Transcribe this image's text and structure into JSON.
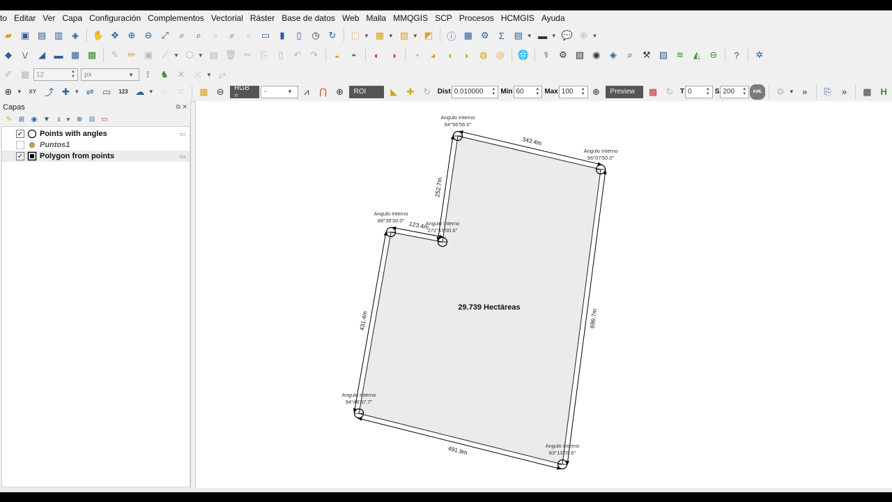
{
  "menu": [
    "to",
    "Editar",
    "Ver",
    "Capa",
    "Configuración",
    "Complementos",
    "Vectorial",
    "Ráster",
    "Base de datos",
    "Web",
    "Malla",
    "MMQGIS",
    "SCP",
    "Procesos",
    "HCMGIS",
    "Ayuda"
  ],
  "label_toolbar": {
    "font_size": "12",
    "unit": "px"
  },
  "scp_toolbar": {
    "rgb_label": "RGB =",
    "rgb_value": "-",
    "roi_label": "ROI",
    "dist_label": "Dist",
    "dist_value": "0.010000",
    "min_label": "Min",
    "min_value": "60",
    "max_label": "Max",
    "max_value": "100",
    "preview_label": "Preview",
    "t_label": "T",
    "t_value": "0",
    "s_label": "S",
    "s_value": "200",
    "kml_label": "KML",
    "more": "»",
    "num_icon": "123"
  },
  "layers_panel": {
    "title": "Capas",
    "layers": [
      {
        "name": "Points with angles",
        "checked": true,
        "icon": "circle-symbol"
      },
      {
        "name": "Puntos1",
        "checked": false,
        "icon": "point-symbol"
      },
      {
        "name": "Polygon from points",
        "checked": true,
        "icon": "polygon-symbol"
      }
    ]
  },
  "map": {
    "area_label": "29.739 Hectáreas",
    "fill_color": "#ebebeb",
    "vertices": [
      {
        "title": "Angulo Interno",
        "angle": "84°56'56.0\""
      },
      {
        "title": "Angulo Interno",
        "angle": "96°07'50.0\""
      },
      {
        "title": "Angulo Interno",
        "angle": "83°13'05.6\""
      },
      {
        "title": "Angulo Interno",
        "angle": "94°48'37.7\""
      },
      {
        "title": "Angulo Interno",
        "angle": "88°39'30.0\""
      },
      {
        "title": "Angulo Interno",
        "angle": "272°15'00.6\""
      }
    ],
    "edges": [
      "343.4m",
      "696.7m",
      "491.9m",
      "431.4m",
      "123.4m",
      "252.7m"
    ]
  }
}
